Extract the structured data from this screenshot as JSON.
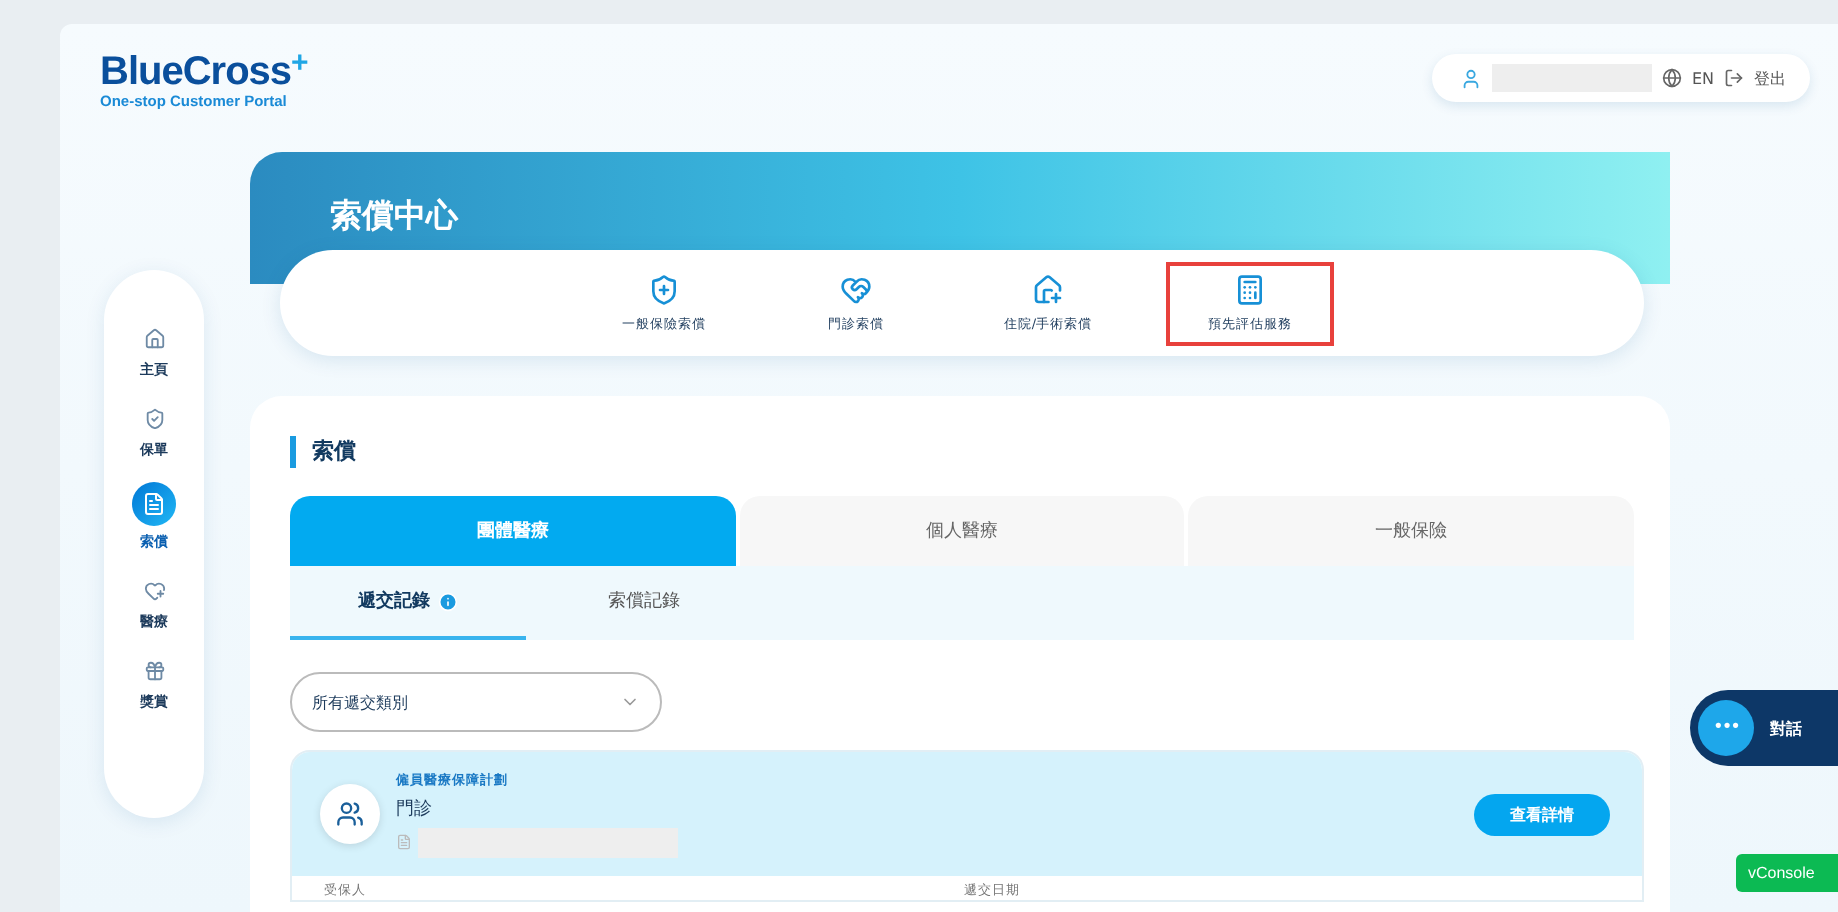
{
  "logo": {
    "name": "BlueCross",
    "plus": "+",
    "tagline": "One-stop Customer Portal"
  },
  "user_bar": {
    "language": "EN",
    "logout": "登出"
  },
  "sidebar": {
    "items": [
      {
        "label": "主頁",
        "selected": false
      },
      {
        "label": "保單",
        "selected": false
      },
      {
        "label": "索償",
        "selected": true
      },
      {
        "label": "醫療",
        "selected": false
      },
      {
        "label": "獎賞",
        "selected": false
      }
    ]
  },
  "banner": {
    "title": "索償中心"
  },
  "quick_menu": [
    {
      "label": "一般保險索償",
      "highlighted": false
    },
    {
      "label": "門診索償",
      "highlighted": false
    },
    {
      "label": "住院/手術索償",
      "highlighted": false
    },
    {
      "label": "預先評估服務",
      "highlighted": true
    }
  ],
  "section": {
    "title": "索償",
    "tabs": [
      {
        "label": "團體醫療",
        "selected": true
      },
      {
        "label": "個人醫療",
        "selected": false
      },
      {
        "label": "一般保險",
        "selected": false
      }
    ],
    "subtabs": [
      {
        "label": "遞交記錄",
        "selected": true,
        "info": true
      },
      {
        "label": "索償記錄",
        "selected": false,
        "info": false
      }
    ],
    "filter": {
      "value": "所有遞交類別"
    },
    "claim": {
      "plan": "僱員醫療保障計劃",
      "type": "門診",
      "action": "查看詳情",
      "fields": [
        "受保人",
        "遞交日期"
      ]
    }
  },
  "chat": {
    "label": "對話",
    "dots": "•••"
  },
  "console": {
    "label": "vConsole"
  }
}
